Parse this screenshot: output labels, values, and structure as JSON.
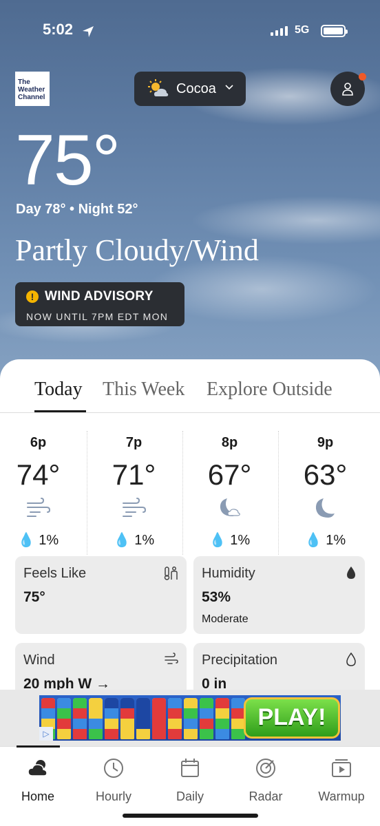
{
  "status_bar": {
    "time": "5:02",
    "network": "5G"
  },
  "logo": {
    "line1": "The",
    "line2": "Weather",
    "line3": "Channel"
  },
  "location": {
    "name": "Cocoa"
  },
  "current": {
    "temperature": "75°",
    "day_night": "Day 78° • Night 52°",
    "condition": "Partly Cloudy/Wind"
  },
  "advisory": {
    "title": "WIND ADVISORY",
    "subtitle": "NOW UNTIL 7PM EDT MON"
  },
  "tabs": [
    {
      "label": "Today",
      "active": true
    },
    {
      "label": "This Week",
      "active": false
    },
    {
      "label": "Explore Outside",
      "active": false
    }
  ],
  "hourly": [
    {
      "time": "6p",
      "temp": "74°",
      "icon": "wind-icon",
      "precip": "1%"
    },
    {
      "time": "7p",
      "temp": "71°",
      "icon": "wind-icon",
      "precip": "1%"
    },
    {
      "time": "8p",
      "temp": "67°",
      "icon": "partly-cloudy-night-icon",
      "precip": "1%"
    },
    {
      "time": "9p",
      "temp": "63°",
      "icon": "moon-icon",
      "precip": "1%"
    }
  ],
  "cards": {
    "feels_like": {
      "label": "Feels Like",
      "value": "75°",
      "icon": "thermometer-person-icon"
    },
    "humidity": {
      "label": "Humidity",
      "value": "53%",
      "sub": "Moderate",
      "icon": "droplet-filled-icon"
    },
    "wind": {
      "label": "Wind",
      "value": "20 mph W",
      "icon": "wind-icon"
    },
    "precipitation": {
      "label": "Precipitation",
      "value": "0 in",
      "icon": "droplet-outline-icon"
    }
  },
  "ad": {
    "button": "PLAY!"
  },
  "nav": [
    {
      "label": "Home",
      "icon": "home-cloud-icon",
      "active": true
    },
    {
      "label": "Hourly",
      "icon": "clock-icon",
      "active": false
    },
    {
      "label": "Daily",
      "icon": "calendar-icon",
      "active": false
    },
    {
      "label": "Radar",
      "icon": "radar-icon",
      "active": false
    },
    {
      "label": "Warmup",
      "icon": "play-video-icon",
      "active": false
    }
  ],
  "colors": {
    "advisory_icon": "#f4b400",
    "profile_badge": "#f05a28",
    "ad_button": "#3fb82a"
  }
}
